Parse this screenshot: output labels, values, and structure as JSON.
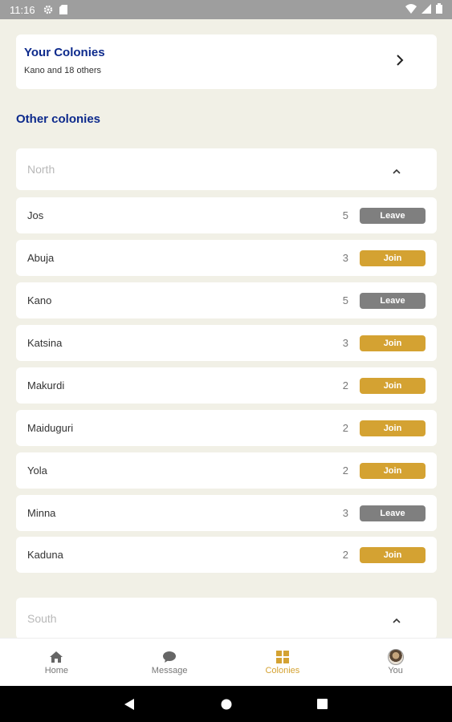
{
  "status_bar": {
    "time": "11:16"
  },
  "your_colonies": {
    "title": "Your Colonies",
    "subtitle": "Kano and 18 others"
  },
  "other_colonies": {
    "title": "Other colonies",
    "groups": [
      {
        "label": "North",
        "rows": [
          {
            "name": "Jos",
            "count": "5",
            "action": "Leave"
          },
          {
            "name": "Abuja",
            "count": "3",
            "action": "Join"
          },
          {
            "name": "Kano",
            "count": "5",
            "action": "Leave"
          },
          {
            "name": "Katsina",
            "count": "3",
            "action": "Join"
          },
          {
            "name": "Makurdi",
            "count": "2",
            "action": "Join"
          },
          {
            "name": "Maiduguri",
            "count": "2",
            "action": "Join"
          },
          {
            "name": "Yola",
            "count": "2",
            "action": "Join"
          },
          {
            "name": "Minna",
            "count": "3",
            "action": "Leave"
          },
          {
            "name": "Kaduna",
            "count": "2",
            "action": "Join"
          }
        ]
      },
      {
        "label": "South"
      }
    ]
  },
  "bottom_nav": {
    "items": [
      {
        "label": "Home",
        "icon": "home-icon"
      },
      {
        "label": "Message",
        "icon": "message-icon"
      },
      {
        "label": "Colonies",
        "icon": "grid-icon",
        "active": true
      },
      {
        "label": "You",
        "icon": "avatar"
      }
    ]
  },
  "colors": {
    "accent": "#d4a232",
    "leave": "#7f7f7f",
    "title_blue": "#0d2a8c",
    "background": "#f1f0e6"
  }
}
